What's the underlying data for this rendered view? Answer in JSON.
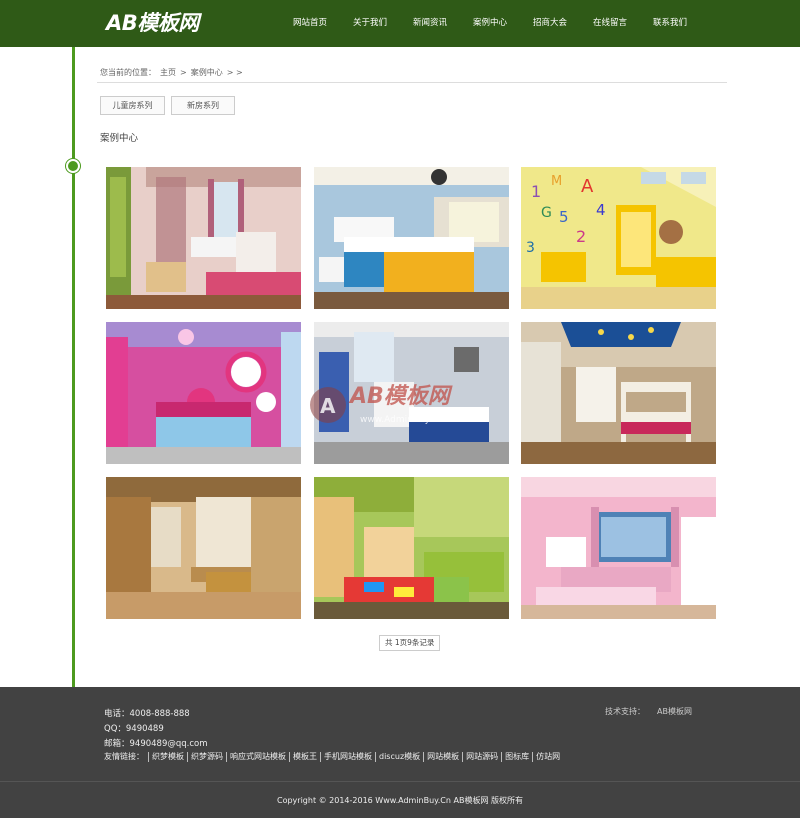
{
  "logo": "AB模板网",
  "nav": [
    "网站首页",
    "关于我们",
    "新闻资讯",
    "案例中心",
    "招商大会",
    "在线留言",
    "联系我们"
  ],
  "breadcrumb": {
    "prefix": "您当前的位置：",
    "home": "主页",
    "sep1": ">",
    "current": "案例中心",
    "tail": "> >"
  },
  "categories": [
    "儿童房系列",
    "新房系列"
  ],
  "section_title": "案例中心",
  "pager": "共 1页9条记录",
  "watermark": {
    "logo": "AB模板网",
    "url": "www.AdminBuy.Cn"
  },
  "footer": {
    "phone": "电话：4008-888-888",
    "qq": "QQ：9490489",
    "email": "邮箱：9490489@qq.com",
    "tech_label": "技术支持：",
    "tech_name": "AB模板网",
    "links_label": "友情链接：",
    "links": [
      "织梦模板",
      "织梦源码",
      "响应式网站模板",
      "模板王",
      "手机网站模板",
      "discuz模板",
      "网站模板",
      "网站源码",
      "图标库",
      "仿站网"
    ],
    "copyright": "Copyright © 2014-2016 Www.AdminBuy.Cn AB模板网 版权所有"
  },
  "colors": {
    "header": "#2f5a17",
    "accent": "#4d9a1f",
    "footer": "#424242"
  }
}
